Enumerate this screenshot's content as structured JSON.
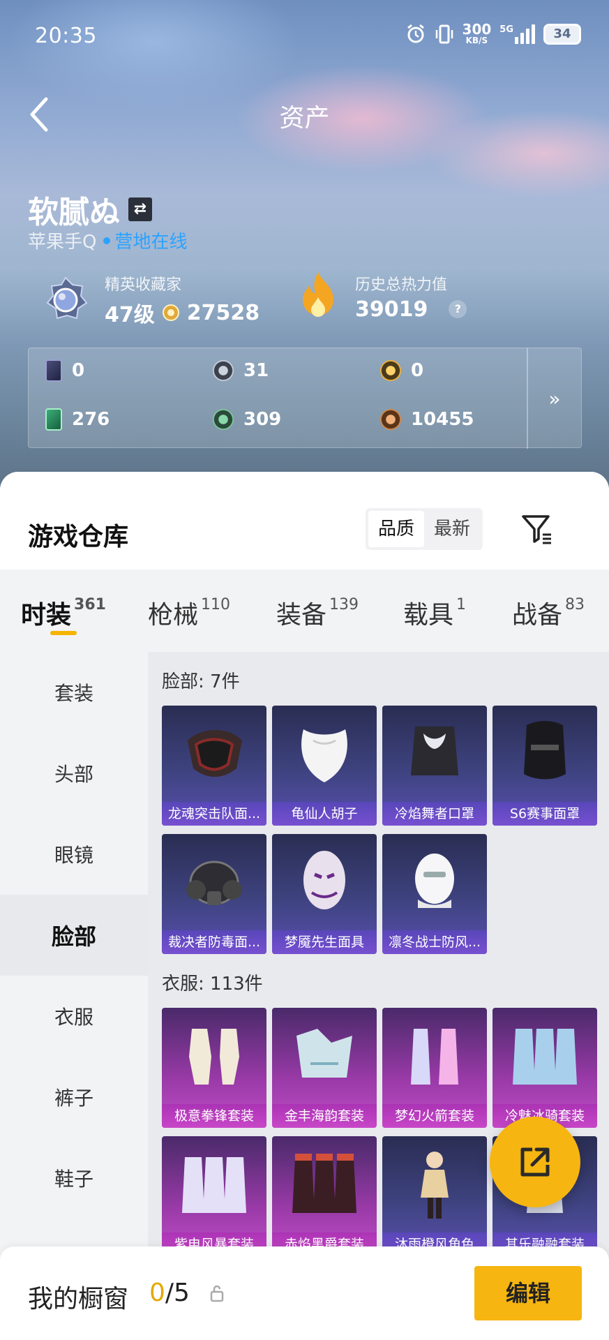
{
  "status_bar": {
    "time": "20:35",
    "speed_value": "300",
    "speed_unit": "KB/S",
    "network": "5G",
    "battery": "34"
  },
  "header": {
    "title": "资产"
  },
  "profile": {
    "username": "软腻ぬ",
    "swap_icon": "swap-icon",
    "platform": "苹果手Q",
    "status": "营地在线",
    "collector_label": "精英收藏家",
    "level": "47级",
    "points": "27528",
    "heat_label": "历史总热力值",
    "heat_value": "39019",
    "heat_help": "?"
  },
  "currencies": [
    {
      "icon": "purple-card-icon",
      "value": "0"
    },
    {
      "icon": "silver-coin-icon",
      "value": "31"
    },
    {
      "icon": "gold-coin-icon",
      "value": "0"
    },
    {
      "icon": "green-card-icon",
      "value": "276"
    },
    {
      "icon": "green-coin-icon",
      "value": "309"
    },
    {
      "icon": "bronze-coin-icon",
      "value": "10455"
    }
  ],
  "warehouse": {
    "title": "游戏仓库",
    "sort_options": [
      "品质",
      "最新"
    ],
    "active_sort": "品质"
  },
  "tabs": [
    {
      "label": "时装",
      "count": "361"
    },
    {
      "label": "枪械",
      "count": "110"
    },
    {
      "label": "装备",
      "count": "139"
    },
    {
      "label": "载具",
      "count": "1"
    },
    {
      "label": "战备",
      "count": "83"
    }
  ],
  "sidebar": [
    "套装",
    "头部",
    "眼镜",
    "脸部",
    "衣服",
    "裤子",
    "鞋子"
  ],
  "sections": [
    {
      "title": "脸部: 7件",
      "items": [
        "龙魂突击队面...",
        "龟仙人胡子",
        "冷焰舞者口罩",
        "S6赛事面罩",
        "裁决者防毒面...",
        "梦魇先生面具",
        "凛冬战士防风..."
      ]
    },
    {
      "title": "衣服: 113件",
      "items": [
        "极意拳锋套装",
        "金丰海韵套装",
        "梦幻火箭套装",
        "冷魅冰骑套装",
        "紫电风暴套装",
        "赤焰黑爵套装",
        "沐雨橙风角色",
        "其乐融融套装"
      ]
    }
  ],
  "showcase": {
    "label": "我的橱窗",
    "current": "0",
    "total": "/5",
    "edit_label": "编辑"
  },
  "colors": {
    "accent": "#f6b510",
    "online": "#2ba3ff",
    "purple_card": "#5b4fb0",
    "pink_card": "#c04ec6"
  }
}
